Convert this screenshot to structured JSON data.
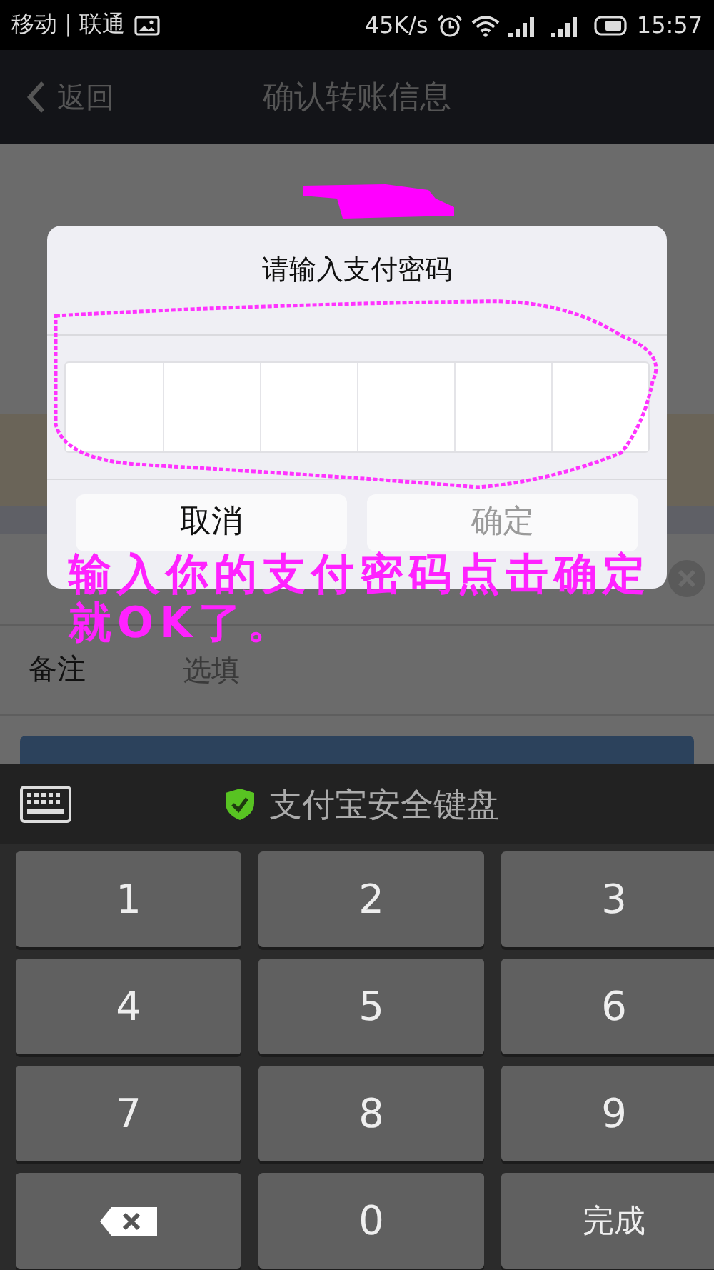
{
  "status_bar": {
    "carrier": "移动 | 联通",
    "speed": "45K/s",
    "time": "15:57"
  },
  "nav": {
    "back": "返回",
    "title": "确认转账信息"
  },
  "form": {
    "rows": [
      {
        "kind": "clearable"
      },
      {
        "kind": "text",
        "label": "备注",
        "placeholder": "选填"
      }
    ]
  },
  "dialog": {
    "title": "请输入支付密码",
    "buttons": [
      {
        "label": "取消",
        "disabled": false
      },
      {
        "label": "确定",
        "disabled": true
      }
    ]
  },
  "annotation": {
    "text": "输入你的支付密码点击确定就OK了。"
  },
  "keyboard": {
    "title": "支付宝安全键盘",
    "keys": [
      {
        "kind": "digit",
        "label": "1"
      },
      {
        "kind": "digit",
        "label": "2"
      },
      {
        "kind": "digit",
        "label": "3"
      },
      {
        "kind": "digit",
        "label": "4"
      },
      {
        "kind": "digit",
        "label": "5"
      },
      {
        "kind": "digit",
        "label": "6"
      },
      {
        "kind": "digit",
        "label": "7"
      },
      {
        "kind": "digit",
        "label": "8"
      },
      {
        "kind": "digit",
        "label": "9"
      },
      {
        "kind": "delete"
      },
      {
        "kind": "digit",
        "label": "0"
      },
      {
        "kind": "action",
        "label": "完成"
      }
    ]
  }
}
